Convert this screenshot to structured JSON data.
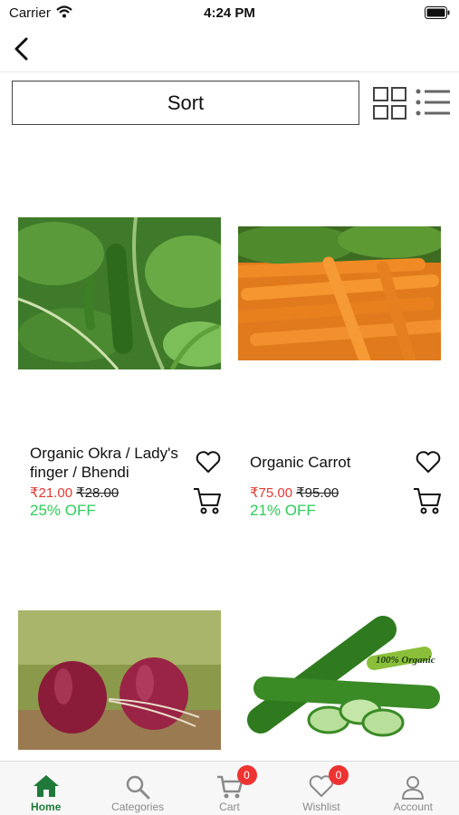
{
  "status_bar": {
    "carrier": "Carrier",
    "time": "4:24 PM"
  },
  "toolbar": {
    "sort_label": "Sort"
  },
  "products": [
    {
      "name": "Organic Okra / Lady's finger /  Bhendi",
      "price": "₹21.00",
      "mrp": "₹28.00",
      "discount": "25% OFF"
    },
    {
      "name": "Organic Carrot",
      "price": "₹75.00",
      "mrp": "₹95.00",
      "discount": "21% OFF"
    },
    {
      "name": "",
      "price": "",
      "mrp": "",
      "discount": ""
    },
    {
      "name": "",
      "price": "",
      "mrp": "",
      "discount": "",
      "image_text": "100% Organic"
    }
  ],
  "tabs": [
    {
      "label": "Home",
      "icon": "home-icon",
      "active": true
    },
    {
      "label": "Categories",
      "icon": "search-icon"
    },
    {
      "label": "Cart",
      "icon": "cart-icon",
      "badge": "0"
    },
    {
      "label": "Wishlist",
      "icon": "heart-icon",
      "badge": "0"
    },
    {
      "label": "Account",
      "icon": "person-icon"
    }
  ],
  "colors": {
    "price": "#e53935",
    "discount": "#2ecc5a",
    "active_tab": "#1f7a3a",
    "badge": "#ee3333"
  }
}
